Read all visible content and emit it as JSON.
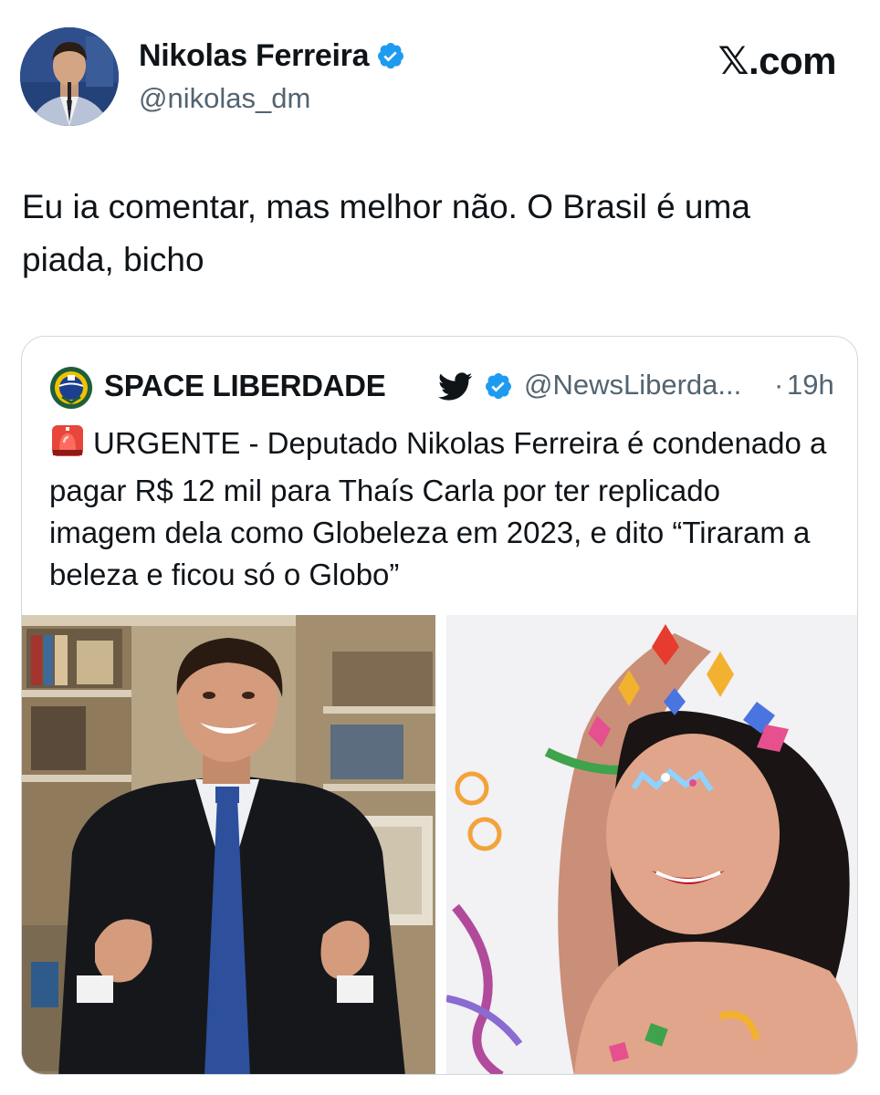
{
  "brand": {
    "label": "𝕏.com"
  },
  "author": {
    "name": "Nikolas Ferreira",
    "handle": "@nikolas_dm",
    "verified": true
  },
  "tweet": {
    "text": "Eu ia comentar, mas melhor não. O Brasil é uma piada, bicho"
  },
  "quoted_tweet": {
    "author_name": "SPACE LIBERDADE",
    "handle": "@NewsLiberda...",
    "separator": "·",
    "time": "19h",
    "verified": true,
    "text": "URGENTE - Deputado Nikolas Ferreira é condenado a pagar R$ 12 mil para Thaís Carla por ter replicado imagem dela como Globeleza em 2023, e dito “Tiraram a beleza e ficou só o Globo”",
    "media": [
      {
        "type": "photo",
        "subject": "man-in-suit"
      },
      {
        "type": "photo",
        "subject": "carnival-woman"
      }
    ]
  },
  "colors": {
    "text": "#0f1419",
    "secondary": "#536471",
    "verified": "#1d9bf0",
    "border": "#cfd9de"
  }
}
